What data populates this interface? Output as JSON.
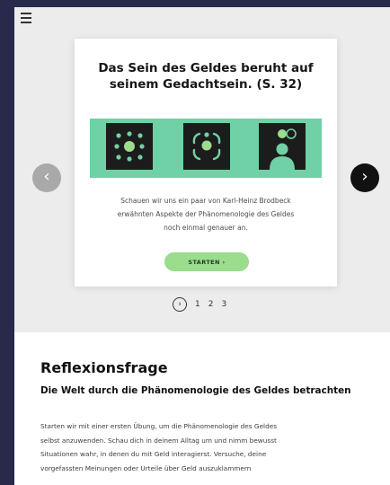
{
  "menu": {
    "icon": "hamburger-menu-icon"
  },
  "slide": {
    "title_line1": "Das Sein des Geldes beruht auf",
    "title_line2": "seinem Gedachtsein. (S. 32)",
    "banner_color": "#6fd1a5",
    "icons": [
      "dot-grid-icon",
      "focus-circle-icon",
      "person-silhouette-icon"
    ],
    "description_lines": [
      "Schauen wir uns ein paar von Karl-Heinz Brodbeck",
      "erwähnten Aspekte der Phänomenologie des Geldes",
      "noch einmal genauer an."
    ],
    "start_button": "STARTEN  ›"
  },
  "carousel": {
    "prev_icon": "chevron-left-icon",
    "next_icon": "chevron-right-icon",
    "prev_glyph": "‹",
    "next_glyph": "›",
    "pager_ring": "›",
    "pages": [
      "1",
      "2",
      "3"
    ]
  },
  "reflection": {
    "heading": "Reflexionsfrage",
    "subheading": "Die Welt durch die Phänomenologie des Geldes betrachten",
    "body_lines": [
      "Starten wir mit einer ersten Übung, um die Phänomenologie des Geldes",
      "selbst anzuwenden. Schau dich in deinem Alltag um und nimm bewusst",
      "Situationen wahr, in denen du mit Geld interagierst. Versuche, deine",
      "vorgefassten Meinungen oder Urteile über Geld auszuklammern"
    ]
  }
}
